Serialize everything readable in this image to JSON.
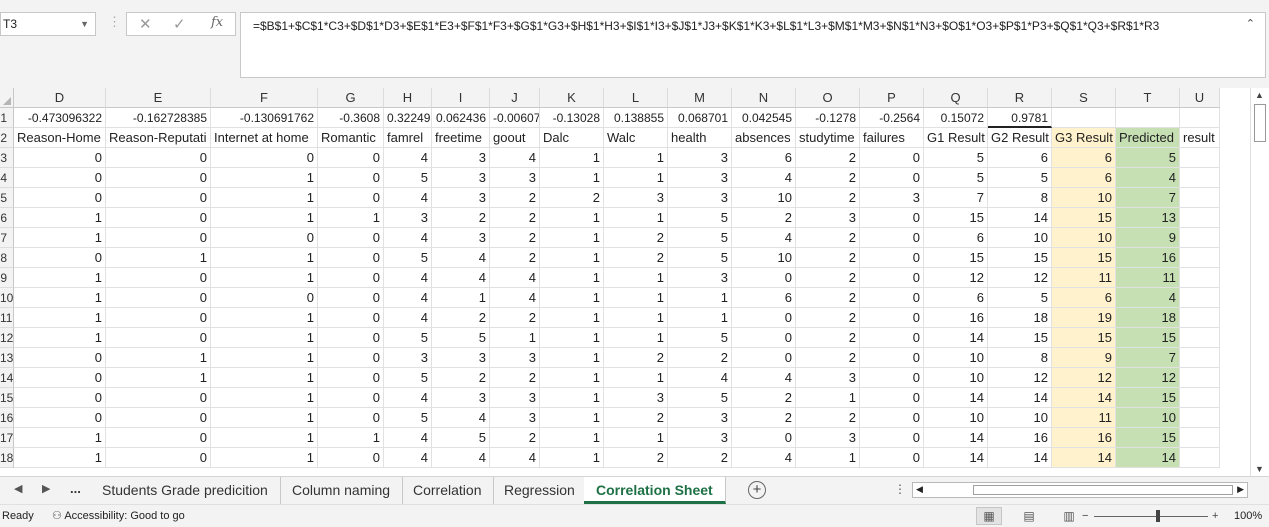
{
  "namebox": {
    "value": "T3"
  },
  "formula_bar": {
    "fx_label": "fx",
    "formula": "=$B$1+$C$1*C3+$D$1*D3+$E$1*E3+$F$1*F3+$G$1*G3+$H$1*H3+$I$1*I3+$J$1*J3+$K$1*K3+$L$1*L3+$M$1*M3+$N$1*N3+$O$1*O3+$P$1*P3+$Q$1*Q3+$R$1*R3"
  },
  "columns": [
    "D",
    "E",
    "F",
    "G",
    "H",
    "I",
    "J",
    "K",
    "L",
    "M",
    "N",
    "O",
    "P",
    "Q",
    "R",
    "S",
    "T",
    "U"
  ],
  "row_numbers": [
    "1",
    "2",
    "3",
    "4",
    "5",
    "6",
    "7",
    "8",
    "9",
    "10",
    "11",
    "12",
    "13",
    "14",
    "15",
    "16",
    "17",
    "18"
  ],
  "rows": [
    [
      "-0.473096322",
      "-0.162728385",
      "-0.130691762",
      "-0.3608",
      "0.322493",
      "0.062436",
      "-0.00607",
      "-0.13028",
      "0.138855",
      "0.068701",
      "0.042545",
      "-0.1278",
      "-0.2564",
      "0.15072",
      "0.9781",
      "",
      "",
      ""
    ],
    [
      "Reason-Home",
      "Reason-Reputati",
      "Internet at home",
      "Romantic",
      "famrel",
      "freetime",
      "goout",
      "Dalc",
      "Walc",
      "health",
      "absences",
      "studytime",
      "failures",
      "G1 Result",
      "G2 Result",
      "G3 Result",
      "Predicted",
      "result"
    ],
    [
      "0",
      "0",
      "0",
      "0",
      "4",
      "3",
      "4",
      "1",
      "1",
      "3",
      "6",
      "2",
      "0",
      "5",
      "6",
      "6",
      "5",
      ""
    ],
    [
      "0",
      "0",
      "1",
      "0",
      "5",
      "3",
      "3",
      "1",
      "1",
      "3",
      "4",
      "2",
      "0",
      "5",
      "5",
      "6",
      "4",
      ""
    ],
    [
      "0",
      "0",
      "1",
      "0",
      "4",
      "3",
      "2",
      "2",
      "3",
      "3",
      "10",
      "2",
      "3",
      "7",
      "8",
      "10",
      "7",
      ""
    ],
    [
      "1",
      "0",
      "1",
      "1",
      "3",
      "2",
      "2",
      "1",
      "1",
      "5",
      "2",
      "3",
      "0",
      "15",
      "14",
      "15",
      "13",
      ""
    ],
    [
      "1",
      "0",
      "0",
      "0",
      "4",
      "3",
      "2",
      "1",
      "2",
      "5",
      "4",
      "2",
      "0",
      "6",
      "10",
      "10",
      "9",
      ""
    ],
    [
      "0",
      "1",
      "1",
      "0",
      "5",
      "4",
      "2",
      "1",
      "2",
      "5",
      "10",
      "2",
      "0",
      "15",
      "15",
      "15",
      "16",
      ""
    ],
    [
      "1",
      "0",
      "1",
      "0",
      "4",
      "4",
      "4",
      "1",
      "1",
      "3",
      "0",
      "2",
      "0",
      "12",
      "12",
      "11",
      "11",
      ""
    ],
    [
      "1",
      "0",
      "0",
      "0",
      "4",
      "1",
      "4",
      "1",
      "1",
      "1",
      "6",
      "2",
      "0",
      "6",
      "5",
      "6",
      "4",
      ""
    ],
    [
      "1",
      "0",
      "1",
      "0",
      "4",
      "2",
      "2",
      "1",
      "1",
      "1",
      "0",
      "2",
      "0",
      "16",
      "18",
      "19",
      "18",
      ""
    ],
    [
      "1",
      "0",
      "1",
      "0",
      "5",
      "5",
      "1",
      "1",
      "1",
      "5",
      "0",
      "2",
      "0",
      "14",
      "15",
      "15",
      "15",
      ""
    ],
    [
      "0",
      "1",
      "1",
      "0",
      "3",
      "3",
      "3",
      "1",
      "2",
      "2",
      "0",
      "2",
      "0",
      "10",
      "8",
      "9",
      "7",
      ""
    ],
    [
      "0",
      "1",
      "1",
      "0",
      "5",
      "2",
      "2",
      "1",
      "1",
      "4",
      "4",
      "3",
      "0",
      "10",
      "12",
      "12",
      "12",
      ""
    ],
    [
      "0",
      "0",
      "1",
      "0",
      "4",
      "3",
      "3",
      "1",
      "3",
      "5",
      "2",
      "1",
      "0",
      "14",
      "14",
      "14",
      "15",
      ""
    ],
    [
      "0",
      "0",
      "1",
      "0",
      "5",
      "4",
      "3",
      "1",
      "2",
      "3",
      "2",
      "2",
      "0",
      "10",
      "10",
      "11",
      "10",
      ""
    ],
    [
      "1",
      "0",
      "1",
      "1",
      "4",
      "5",
      "2",
      "1",
      "1",
      "3",
      "0",
      "3",
      "0",
      "14",
      "16",
      "16",
      "15",
      ""
    ],
    [
      "1",
      "0",
      "1",
      "0",
      "4",
      "4",
      "4",
      "1",
      "2",
      "2",
      "4",
      "1",
      "0",
      "14",
      "14",
      "14",
      "14",
      ""
    ]
  ],
  "highlight_colors": {
    "S": "#fff2cc",
    "T": "#c6e0b4"
  },
  "sheet_tabs": [
    "Students Grade predicition",
    "Column naming",
    "Correlation",
    "Regression",
    "Correlation Sheet"
  ],
  "active_tab": "Correlation Sheet",
  "tab_nav": {
    "more": "..."
  },
  "status": {
    "ready": "Ready",
    "accessibility": "Accessibility: Good to go",
    "zoom": "100%"
  }
}
